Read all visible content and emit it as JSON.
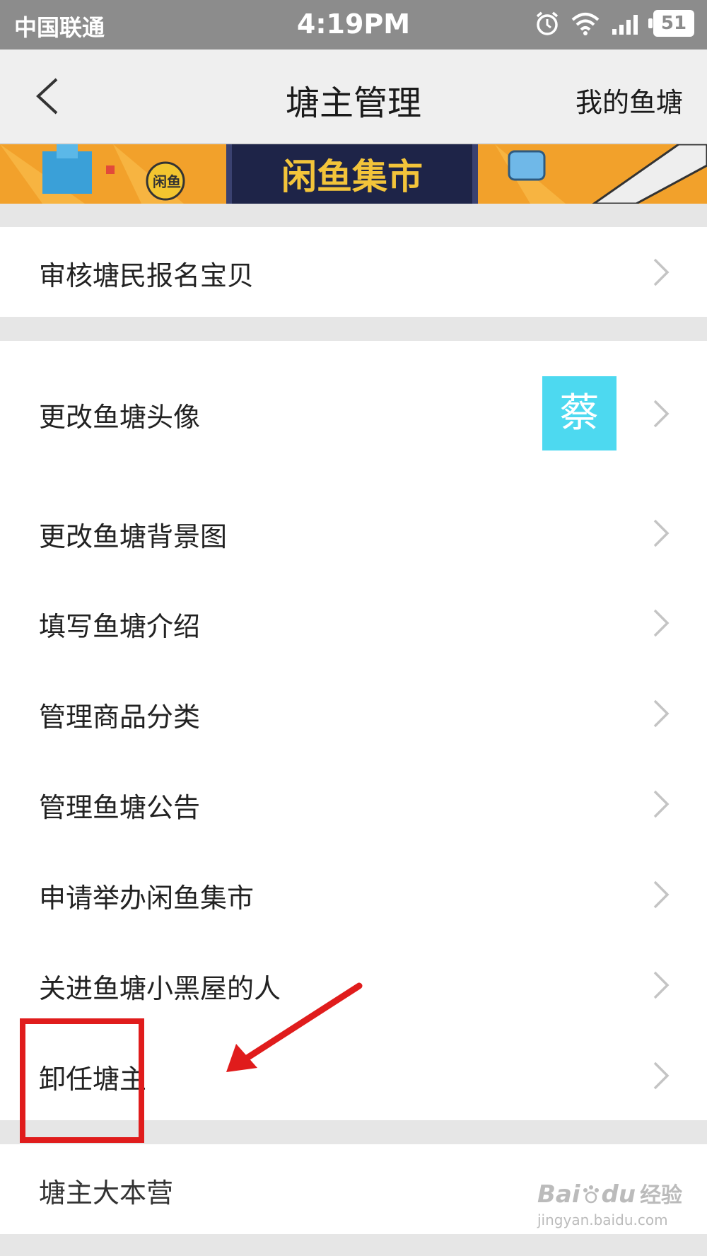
{
  "status_bar": {
    "carrier": "中国联通",
    "time": "4:19PM",
    "battery": "51"
  },
  "nav": {
    "title": "塘主管理",
    "right_link": "我的鱼塘"
  },
  "banner": {
    "text": "闲鱼集市",
    "badge": "闲鱼"
  },
  "menu": {
    "review": "审核塘民报名宝贝",
    "avatar_label": "更改鱼塘头像",
    "avatar_char": "蔡",
    "background": "更改鱼塘背景图",
    "intro": "填写鱼塘介绍",
    "categories": "管理商品分类",
    "announcement": "管理鱼塘公告",
    "market": "申请举办闲鱼集市",
    "blacklist": "关进鱼塘小黑屋的人",
    "resign": "卸任塘主",
    "hq": "塘主大本营"
  },
  "watermark": {
    "brand": "Bai",
    "brand2": "du",
    "cn": "经验",
    "url": "jingyan.baidu.com"
  },
  "colors": {
    "accent_avatar": "#4dd9f0",
    "highlight_red": "#e01c1c",
    "banner_orange": "#f2a12b"
  }
}
